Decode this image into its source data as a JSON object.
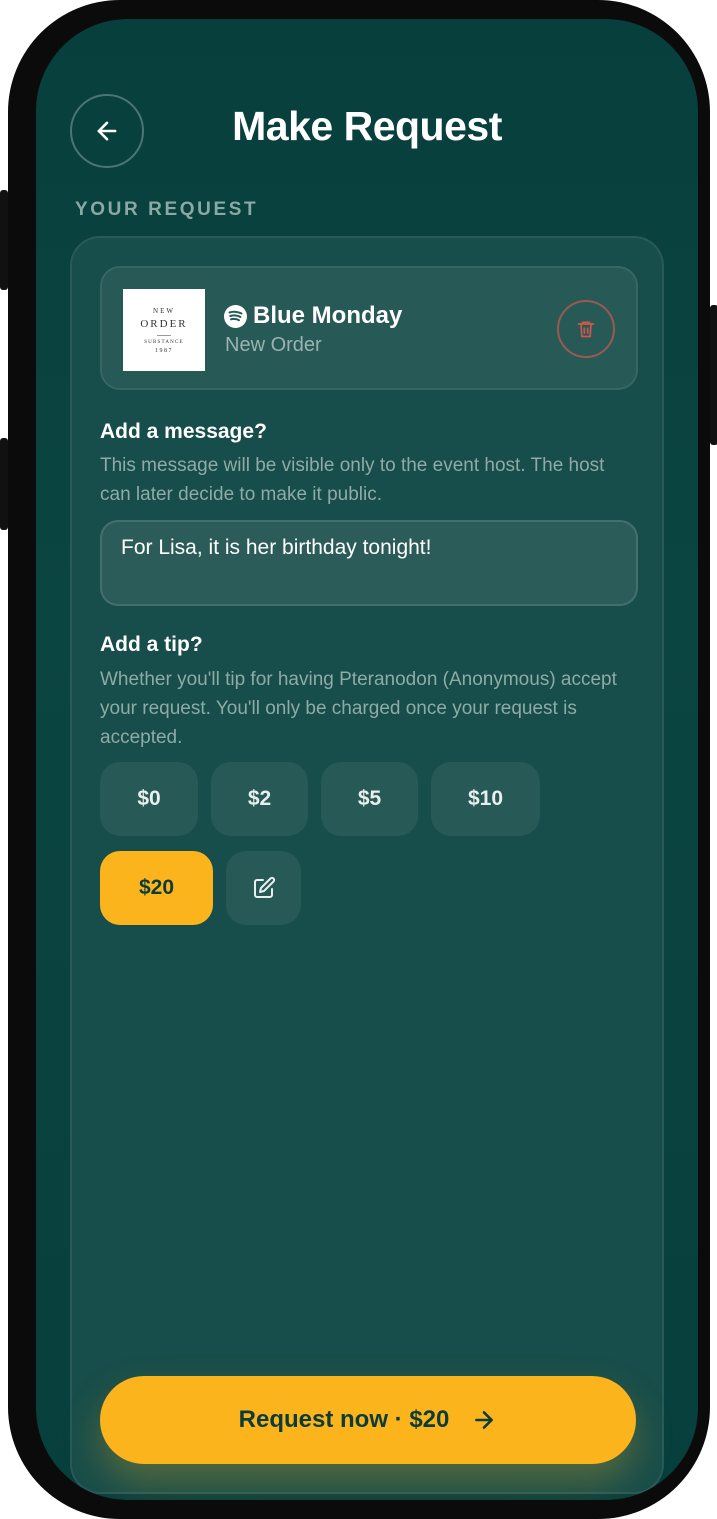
{
  "header": {
    "title": "Make Request",
    "section_label": "YOUR REQUEST"
  },
  "track": {
    "title": "Blue Monday",
    "artist": "New Order",
    "album_art": {
      "line1": "NEW",
      "line2": "ORDER",
      "line3": "SUBSTANCE",
      "line4": "1987"
    }
  },
  "message": {
    "label": "Add a message?",
    "help": "This message will be visible only to the event host. The host can later decide to make it public.",
    "value": "For Lisa, it is her birthday tonight!"
  },
  "tip": {
    "label": "Add a tip?",
    "help": "Whether you'll tip for having Pteranodon (Anonymous) accept your request. You'll only be charged once your request is accepted.",
    "options": [
      "$0",
      "$2",
      "$5",
      "$10",
      "$20"
    ],
    "selected": "$20"
  },
  "cta": {
    "label": "Request now · $20"
  },
  "colors": {
    "background": "#073f3d",
    "card": "#174d4a",
    "accent": "#fbb41c",
    "delete": "#d0584a"
  }
}
